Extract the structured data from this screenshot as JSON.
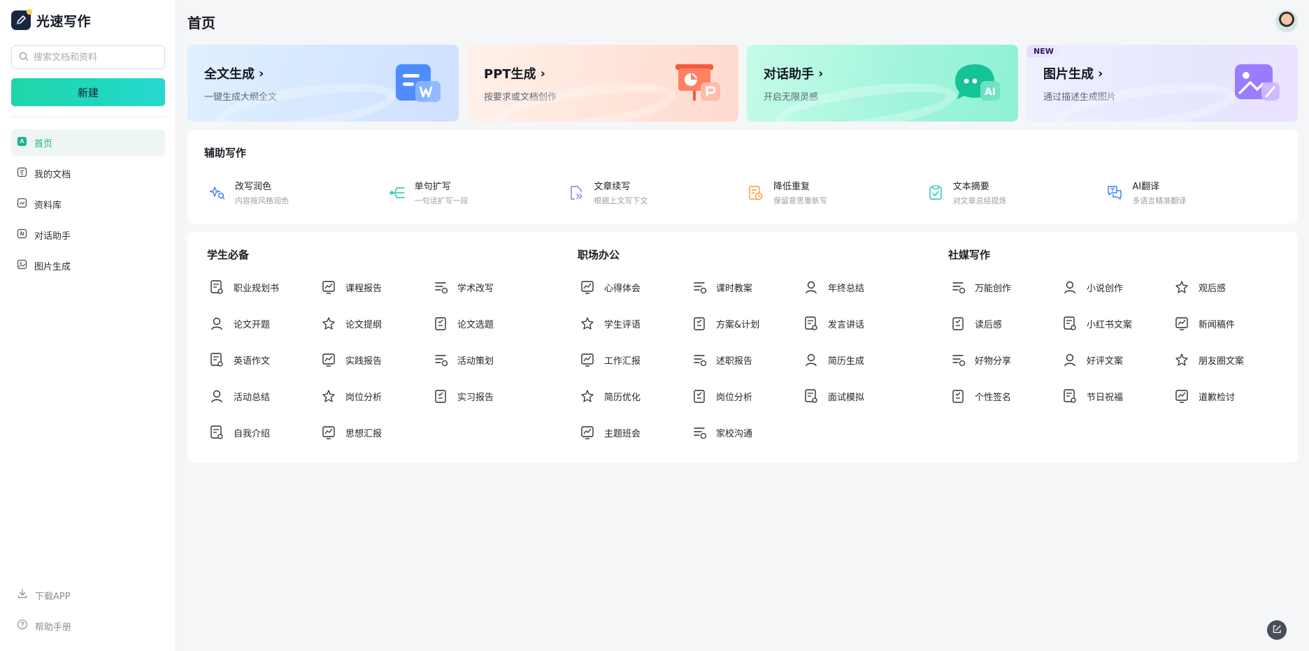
{
  "brand": {
    "name": "光速写作",
    "icon": "pen-logo-icon"
  },
  "sidebar": {
    "search_placeholder": "搜索文档和资料",
    "new_button": "新建",
    "items": [
      {
        "label": "首页",
        "icon": "home-icon",
        "active": true
      },
      {
        "label": "我的文档",
        "icon": "document-icon"
      },
      {
        "label": "资料库",
        "icon": "library-icon"
      },
      {
        "label": "对话助手",
        "icon": "chat-icon"
      },
      {
        "label": "图片生成",
        "icon": "image-icon"
      }
    ],
    "bottom": [
      {
        "label": "下载APP",
        "icon": "download-icon"
      },
      {
        "label": "帮助手册",
        "icon": "help-icon"
      }
    ]
  },
  "header": {
    "title": "首页",
    "avatar": "user-avatar"
  },
  "cards": [
    {
      "title": "全文生成",
      "subtitle": "一键生成大纲全文",
      "icon": "word-document-icon",
      "color": "#4e8cff"
    },
    {
      "title": "PPT生成",
      "subtitle": "按要求或文档创作",
      "icon": "presentation-icon",
      "color": "#ff7a59"
    },
    {
      "title": "对话助手",
      "subtitle": "开启无限灵感",
      "icon": "ai-chat-icon",
      "color": "#17c59a"
    },
    {
      "title": "图片生成",
      "subtitle": "通过描述生成图片",
      "icon": "image-generate-icon",
      "color": "#9a7cff",
      "badge": "NEW"
    }
  ],
  "assist": {
    "title": "辅助写作",
    "items": [
      {
        "name": "改写润色",
        "desc": "内容按风格润色",
        "icon": "sparkle-rewrite-icon",
        "color": "#3a7bff"
      },
      {
        "name": "单句扩写",
        "desc": "一句话扩写一段",
        "icon": "expand-lines-icon",
        "color": "#1fc3a7"
      },
      {
        "name": "文章续写",
        "desc": "根据上文写下文",
        "icon": "continue-doc-icon",
        "color": "#9a6cff"
      },
      {
        "name": "降低重复",
        "desc": "保留意思重新写",
        "icon": "reduce-duplicate-icon",
        "color": "#ff9a2e"
      },
      {
        "name": "文本摘要",
        "desc": "对文章总结提炼",
        "icon": "summary-check-icon",
        "color": "#1fc3a7"
      },
      {
        "name": "AI翻译",
        "desc": "多语言精准翻译",
        "icon": "translate-icon",
        "color": "#3a7bff"
      }
    ]
  },
  "categories": [
    {
      "title": "学生必备",
      "tools": [
        {
          "label": "职业规划书",
          "icon": "career-plan-icon"
        },
        {
          "label": "课程报告",
          "icon": "course-report-icon"
        },
        {
          "label": "学术改写",
          "icon": "academic-rewrite-icon"
        },
        {
          "label": "论文开题",
          "icon": "thesis-proposal-icon"
        },
        {
          "label": "论文提纲",
          "icon": "thesis-outline-icon"
        },
        {
          "label": "论文选题",
          "icon": "thesis-topic-icon"
        },
        {
          "label": "英语作文",
          "icon": "english-essay-icon"
        },
        {
          "label": "实践报告",
          "icon": "practice-report-icon"
        },
        {
          "label": "活动策划",
          "icon": "event-plan-icon"
        },
        {
          "label": "活动总结",
          "icon": "event-summary-icon"
        },
        {
          "label": "岗位分析",
          "icon": "job-analysis-icon"
        },
        {
          "label": "实习报告",
          "icon": "internship-report-icon"
        },
        {
          "label": "自我介绍",
          "icon": "self-intro-icon"
        },
        {
          "label": "思想汇报",
          "icon": "thought-report-icon"
        }
      ]
    },
    {
      "title": "职场办公",
      "tools": [
        {
          "label": "心得体会",
          "icon": "reflection-icon"
        },
        {
          "label": "课时教案",
          "icon": "lesson-plan-icon"
        },
        {
          "label": "年终总结",
          "icon": "year-summary-icon"
        },
        {
          "label": "学生评语",
          "icon": "student-comment-icon"
        },
        {
          "label": "方案&计划",
          "icon": "plan-icon"
        },
        {
          "label": "发言讲话",
          "icon": "speech-icon"
        },
        {
          "label": "工作汇报",
          "icon": "work-report-icon"
        },
        {
          "label": "述职报告",
          "icon": "duty-report-icon"
        },
        {
          "label": "简历生成",
          "icon": "resume-generate-icon"
        },
        {
          "label": "简历优化",
          "icon": "resume-optimize-icon"
        },
        {
          "label": "岗位分析",
          "icon": "job-analysis-icon"
        },
        {
          "label": "面试模拟",
          "icon": "interview-icon"
        },
        {
          "label": "主题班会",
          "icon": "class-meeting-icon"
        },
        {
          "label": "家校沟通",
          "icon": "handshake-icon"
        }
      ]
    },
    {
      "title": "社媒写作",
      "tools": [
        {
          "label": "万能创作",
          "icon": "universal-create-icon"
        },
        {
          "label": "小说创作",
          "icon": "novel-icon"
        },
        {
          "label": "观后感",
          "icon": "movie-review-icon"
        },
        {
          "label": "读后感",
          "icon": "book-review-icon"
        },
        {
          "label": "小红书文案",
          "icon": "xiaohongshu-icon"
        },
        {
          "label": "新闻稿件",
          "icon": "news-icon"
        },
        {
          "label": "好物分享",
          "icon": "product-share-icon"
        },
        {
          "label": "好评文案",
          "icon": "thumbs-up-icon"
        },
        {
          "label": "朋友圈文案",
          "icon": "moments-icon"
        },
        {
          "label": "个性签名",
          "icon": "signature-icon"
        },
        {
          "label": "节日祝福",
          "icon": "festival-icon"
        },
        {
          "label": "道歉检讨",
          "icon": "apology-icon"
        }
      ]
    }
  ],
  "floating_button": {
    "icon": "edit-icon"
  }
}
